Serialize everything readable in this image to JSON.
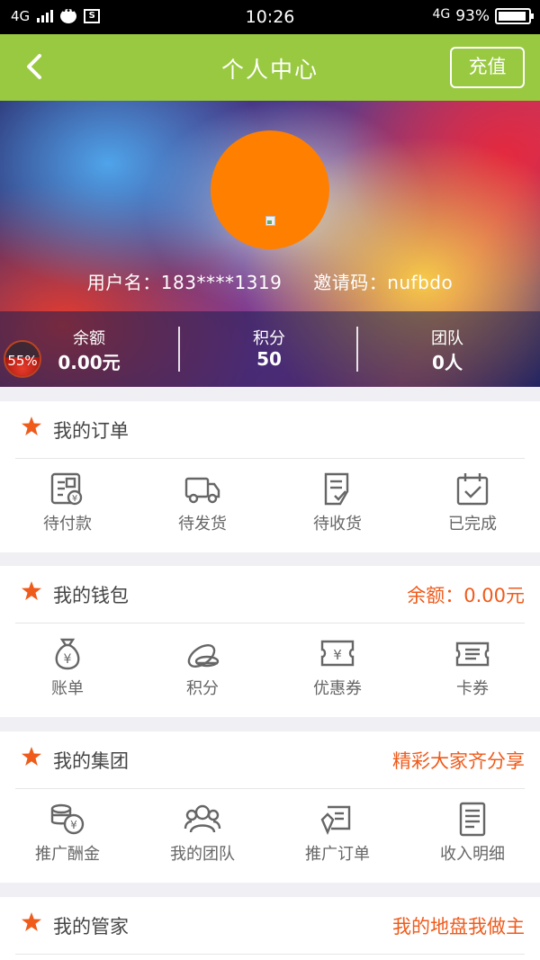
{
  "status_bar": {
    "network_left": "4G",
    "time": "10:26",
    "network_right": "4G",
    "battery": "93%",
    "battery_level": 0.93,
    "icons": [
      "signal-icon",
      "chat-icon",
      "screenshot-icon",
      "battery-icon"
    ]
  },
  "header": {
    "title": "个人中心",
    "back_icon": "chevron-left-icon",
    "recharge_label": "充值",
    "bg_color": "#99c940"
  },
  "profile": {
    "avatar_color": "#ff7f00",
    "username": "用户名：183****1319",
    "invite_code": "邀请码：nufbdo",
    "stats": [
      {
        "label": "余额",
        "value": "0.00元"
      },
      {
        "label": "积分",
        "value": "50"
      },
      {
        "label": "团队",
        "value": "0人"
      }
    ],
    "progress_badge": {
      "text": "55%",
      "value": 0.55
    }
  },
  "sections": {
    "orders": {
      "title": "我的订单",
      "items": [
        {
          "label": "待付款",
          "icon": "pending-payment-icon"
        },
        {
          "label": "待发货",
          "icon": "delivery-truck-icon"
        },
        {
          "label": "待收货",
          "icon": "receive-goods-icon"
        },
        {
          "label": "已完成",
          "icon": "completed-calendar-icon"
        }
      ]
    },
    "wallet": {
      "title": "我的钱包",
      "extra": "余额：0.00元",
      "items": [
        {
          "label": "账单",
          "icon": "money-bag-icon"
        },
        {
          "label": "积分",
          "icon": "coins-icon"
        },
        {
          "label": "优惠券",
          "icon": "coupon-icon"
        },
        {
          "label": "卡券",
          "icon": "card-voucher-icon"
        }
      ]
    },
    "group": {
      "title": "我的集团",
      "extra": "精彩大家齐分享",
      "items": [
        {
          "label": "推广酬金",
          "icon": "commission-coins-icon"
        },
        {
          "label": "我的团队",
          "icon": "team-icon"
        },
        {
          "label": "推广订单",
          "icon": "promotion-order-icon"
        },
        {
          "label": "收入明细",
          "icon": "income-detail-icon"
        }
      ]
    },
    "steward": {
      "title": "我的管家",
      "extra": "我的地盘我做主"
    }
  },
  "colors": {
    "accent_orange": "#ef5b1b",
    "header_green": "#99c940"
  }
}
